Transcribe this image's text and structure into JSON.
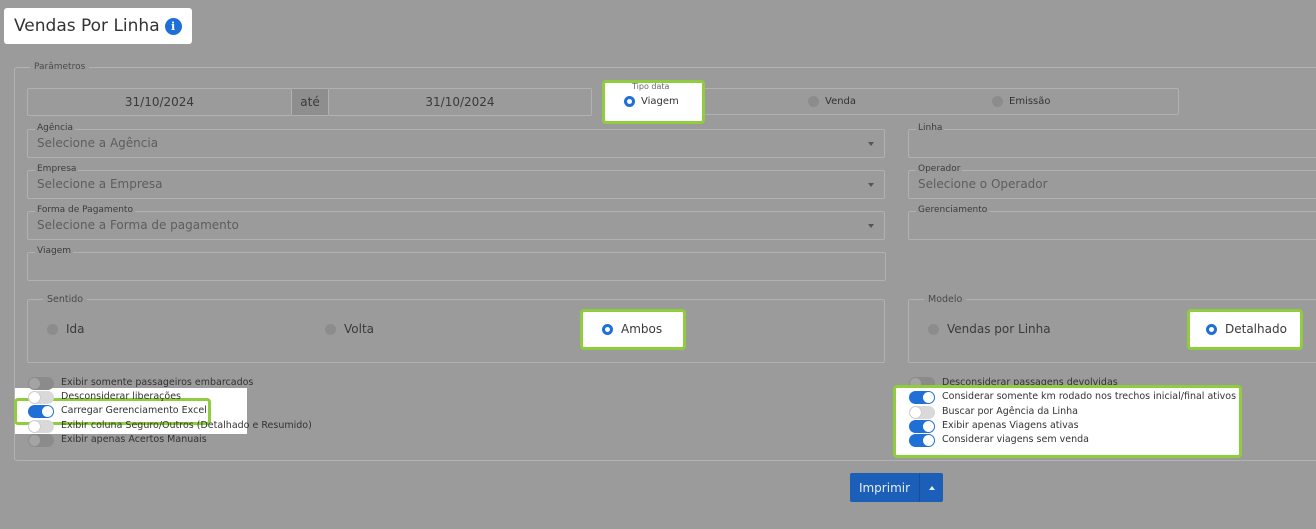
{
  "header": {
    "title": "Vendas Por Linha",
    "info_icon": "i"
  },
  "params": {
    "legend": "Parâmetros"
  },
  "dates": {
    "start": "31/10/2024",
    "separator": "até",
    "end": "31/10/2024"
  },
  "tipo_data": {
    "label": "Tipo data",
    "options": [
      "Viagem",
      "Venda",
      "Emissão"
    ],
    "selected": "Viagem"
  },
  "fields": {
    "agencia": {
      "label": "Agência",
      "placeholder": "Selecione a Agência"
    },
    "empresa": {
      "label": "Empresa",
      "placeholder": "Selecione a Empresa"
    },
    "forma": {
      "label": "Forma de Pagamento",
      "placeholder": "Selecione a Forma de pagamento"
    },
    "viagem": {
      "label": "Viagem",
      "value": ""
    },
    "linha": {
      "label": "Linha",
      "value": ""
    },
    "operador": {
      "label": "Operador",
      "placeholder": "Selecione o Operador"
    },
    "gerenciamento": {
      "label": "Gerenciamento",
      "value": ""
    }
  },
  "sentido": {
    "label": "Sentido",
    "options": [
      "Ida",
      "Volta",
      "Ambos"
    ],
    "selected": "Ambos"
  },
  "modelo": {
    "label": "Modelo",
    "options": [
      "Vendas por Linha",
      "Detalhado"
    ],
    "selected": "Detalhado"
  },
  "toggles_left": [
    {
      "label": "Exibir somente passageiros embarcados",
      "on": false
    },
    {
      "label": "Desconsiderar liberações",
      "on": false
    },
    {
      "label": "Carregar Gerenciamento Excel",
      "on": true
    },
    {
      "label": "Exibir coluna Seguro/Outros (Detalhado e Resumido)",
      "on": false
    },
    {
      "label": "Exibir apenas Acertos Manuais",
      "on": false
    }
  ],
  "toggles_right": [
    {
      "label": "Desconsiderar passagens devolvidas",
      "on": false
    },
    {
      "label": "Considerar somente km rodado nos trechos inicial/final ativos",
      "on": true
    },
    {
      "label": "Buscar por Agência da Linha",
      "on": false
    },
    {
      "label": "Exibir apenas Viagens ativas",
      "on": true
    },
    {
      "label": "Considerar viagens sem venda",
      "on": true
    }
  ],
  "actions": {
    "print_label": "Imprimir"
  },
  "colors": {
    "accent": "#1f6fd6",
    "highlight": "#8fcd3f",
    "overlay": "#9b9b9b"
  }
}
